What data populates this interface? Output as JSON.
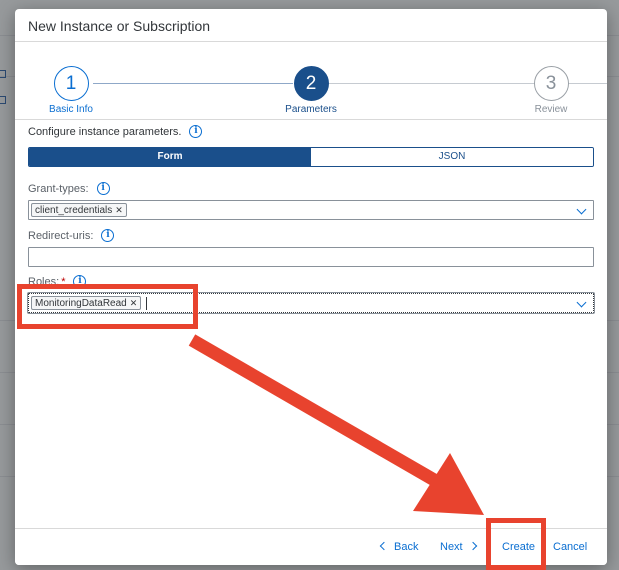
{
  "dialog": {
    "title": "New Instance or Subscription"
  },
  "wizard": {
    "steps": [
      {
        "number": "1",
        "label": "Basic Info",
        "state": "completed"
      },
      {
        "number": "2",
        "label": "Parameters",
        "state": "active"
      },
      {
        "number": "3",
        "label": "Review",
        "state": "inactive"
      }
    ]
  },
  "content": {
    "intro": "Configure instance parameters.",
    "modes": {
      "form": "Form",
      "json": "JSON",
      "selected": "Form"
    },
    "fields": {
      "grant_types": {
        "label": "Grant-types:",
        "tokens": [
          "client_credentials"
        ],
        "token_remove": "✕"
      },
      "redirect_uris": {
        "label": "Redirect-uris:",
        "value": ""
      },
      "roles": {
        "label": "Roles:",
        "required_mark": "*",
        "tokens": [
          "MonitoringDataRead"
        ],
        "token_remove": "✕"
      }
    }
  },
  "footer": {
    "back": "Back",
    "next": "Next",
    "create": "Create",
    "cancel": "Cancel"
  },
  "icons": {
    "info": "i"
  },
  "colors": {
    "accent": "#0a6ed1",
    "active_step": "#1a4f8b",
    "annotation": "#e8432e"
  }
}
